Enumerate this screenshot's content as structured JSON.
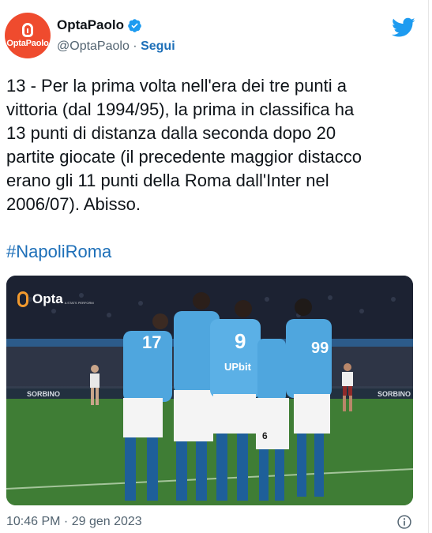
{
  "author": {
    "avatar_text": "OptaPaolo",
    "display_name": "OptaPaolo",
    "handle": "@OptaPaolo",
    "separator": " · ",
    "follow_label": "Segui",
    "verified": true
  },
  "tweet": {
    "text": "13 - Per la prima volta nell'era dei tre punti a\nvittoria (dal 1994/95), la prima in classifica ha\n13 punti di distanza dalla seconda dopo 20\npartite giocate (il precedente maggior distacco\nerano gli 11 punti della Roma dall'Inter nel\n2006/07). Abisso.",
    "hashtag": "#NapoliRoma"
  },
  "media": {
    "logo_text": "Opta",
    "logo_subtext": "A STATS PERFORM",
    "board_text": "SORBINO",
    "shirt_text": "UPbit",
    "shirt_numbers": [
      "17",
      "9",
      "99",
      "6"
    ]
  },
  "footer": {
    "time": "10:46 PM",
    "separator": " · ",
    "date": "29 gen 2023"
  },
  "colors": {
    "brand_orange": "#ef4b2e",
    "twitter_blue": "#1d9bf0",
    "link_blue": "#1d6fb8",
    "napoli_blue": "#4fa6de"
  },
  "icons": [
    "verified-badge-icon",
    "twitter-bird-icon",
    "info-icon",
    "opta-logo-icon"
  ]
}
